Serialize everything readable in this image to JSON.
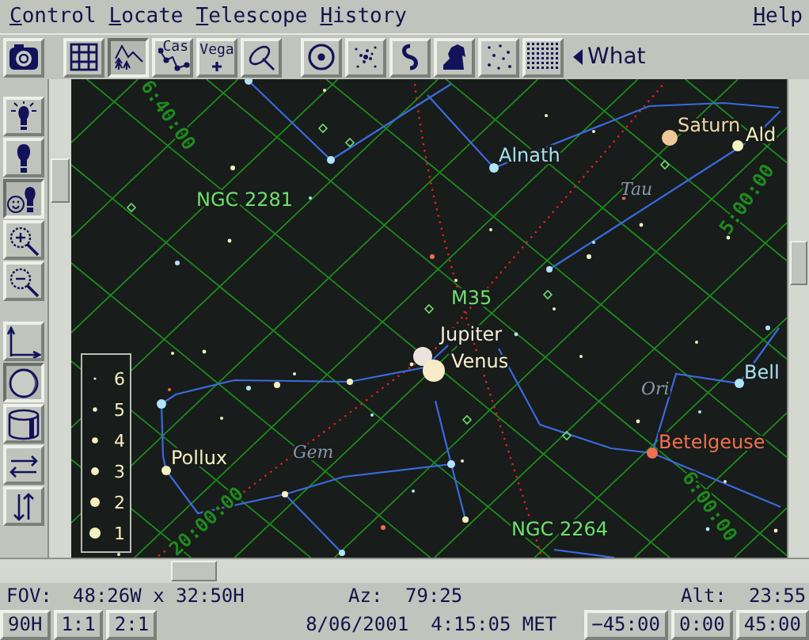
{
  "menu": [
    {
      "label": "Control"
    },
    {
      "label": "Locate"
    },
    {
      "label": "Telescope"
    },
    {
      "label": "History"
    }
  ],
  "help": {
    "label": "Help"
  },
  "toolbar": {
    "camera": {
      "on": false
    },
    "groups": [
      [
        {
          "kind": "grid",
          "on": false
        },
        {
          "kind": "horizon",
          "on": true
        },
        {
          "kind": "figures",
          "text": "Cas",
          "on": false
        },
        {
          "kind": "names",
          "text": "Vega",
          "on": false
        },
        {
          "kind": "orbit",
          "on": false
        }
      ],
      [
        {
          "kind": "planets",
          "on": false
        },
        {
          "kind": "clusters",
          "on": false
        },
        {
          "kind": "galaxies",
          "on": false
        },
        {
          "kind": "nebulae",
          "on": false
        },
        {
          "kind": "stars",
          "on": false
        },
        {
          "kind": "dense",
          "on": false
        }
      ]
    ],
    "what": "What"
  },
  "side_tools": [
    {
      "kind": "bright",
      "on": false
    },
    {
      "kind": "dim",
      "on": false
    },
    {
      "kind": "face",
      "on": true
    },
    {
      "kind": "zoom_in",
      "on": false
    },
    {
      "kind": "zoom_out",
      "on": false
    },
    {
      "kind": "axes",
      "on": false
    },
    {
      "kind": "moon",
      "on": true
    },
    {
      "kind": "cylinder",
      "on": false
    },
    {
      "kind": "flip_h",
      "on": false
    },
    {
      "kind": "flip_v",
      "on": false
    }
  ],
  "chart": {
    "labels": [
      {
        "text": "6:40:00",
        "kind": "grid",
        "color": "#1f8a1f"
      },
      {
        "text": "NGC 2281",
        "kind": "deep_sky",
        "color": "#6ee06e"
      },
      {
        "text": "Alnath",
        "kind": "star",
        "color": "#a8e0f0"
      },
      {
        "text": "Saturn",
        "kind": "planet",
        "color": "#f0d8a8"
      },
      {
        "text": "Ald",
        "kind": "star",
        "color": "#f4f4c0"
      },
      {
        "text": "Tau",
        "kind": "constellation",
        "color": "#8898a8"
      },
      {
        "text": "5:00:00",
        "kind": "grid",
        "color": "#1f8a1f"
      },
      {
        "text": "M35",
        "kind": "deep_sky",
        "color": "#6ee06e"
      },
      {
        "text": "Jupiter",
        "kind": "planet",
        "color": "#f4ece0"
      },
      {
        "text": "Venus",
        "kind": "planet",
        "color": "#f8f0d0"
      },
      {
        "text": "Ori",
        "kind": "constellation",
        "color": "#8898a8"
      },
      {
        "text": "Bell",
        "kind": "star",
        "color": "#a8e0f0"
      },
      {
        "text": "Betelgeuse",
        "kind": "star",
        "color": "#f07050"
      },
      {
        "text": "Pollux",
        "kind": "star",
        "color": "#f4f0c0"
      },
      {
        "text": "Gem",
        "kind": "constellation",
        "color": "#8898a8"
      },
      {
        "text": "20:00:00",
        "kind": "grid",
        "color": "#1f8a1f"
      },
      {
        "text": "6:00:00",
        "kind": "grid",
        "color": "#1f8a1f"
      },
      {
        "text": "NGC 2264",
        "kind": "deep_sky",
        "color": "#6ee06e"
      }
    ],
    "legend": [
      "6",
      "5",
      "4",
      "3",
      "2",
      "1"
    ]
  },
  "status": {
    "fov_label": "FOV:",
    "fov": "48:26W x 32:50H",
    "az_label": "Az:",
    "az": "79:25",
    "alt_label": "Alt:",
    "alt": "23:55"
  },
  "left_buttons": [
    "90H",
    "1:1",
    "2:1"
  ],
  "date": "8/06/2001",
  "time": "4:15:05 MET",
  "right_buttons": [
    "−45:00",
    "0:00",
    "45:00"
  ]
}
